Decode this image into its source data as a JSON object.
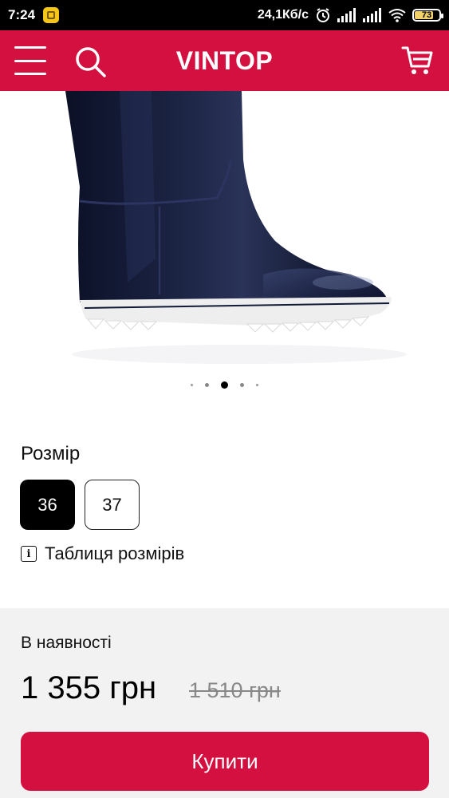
{
  "status_bar": {
    "time": "7:24",
    "network_speed": "24,1Кб/с",
    "battery_level": "73",
    "icons": [
      "app-notification-icon",
      "alarm-icon",
      "signal-icon",
      "signal-icon",
      "wifi-icon",
      "battery-icon"
    ]
  },
  "header": {
    "brand": "VINTOP",
    "background_color": "#d3103f",
    "icons": [
      "menu-icon",
      "search-icon",
      "cart-icon"
    ]
  },
  "gallery": {
    "image_subject": "navy glossy rubber boot with white sole",
    "dot_count": 5,
    "active_dot_index": 2
  },
  "size_section": {
    "label": "Розмір",
    "options": [
      {
        "label": "36",
        "selected": true
      },
      {
        "label": "37",
        "selected": false
      }
    ],
    "size_table_label": "Таблиця розмірів"
  },
  "purchase": {
    "availability": "В наявності",
    "price": "1 355 грн",
    "old_price": "1 510 грн",
    "buy_label": "Купити",
    "accent_color": "#d3103f"
  }
}
